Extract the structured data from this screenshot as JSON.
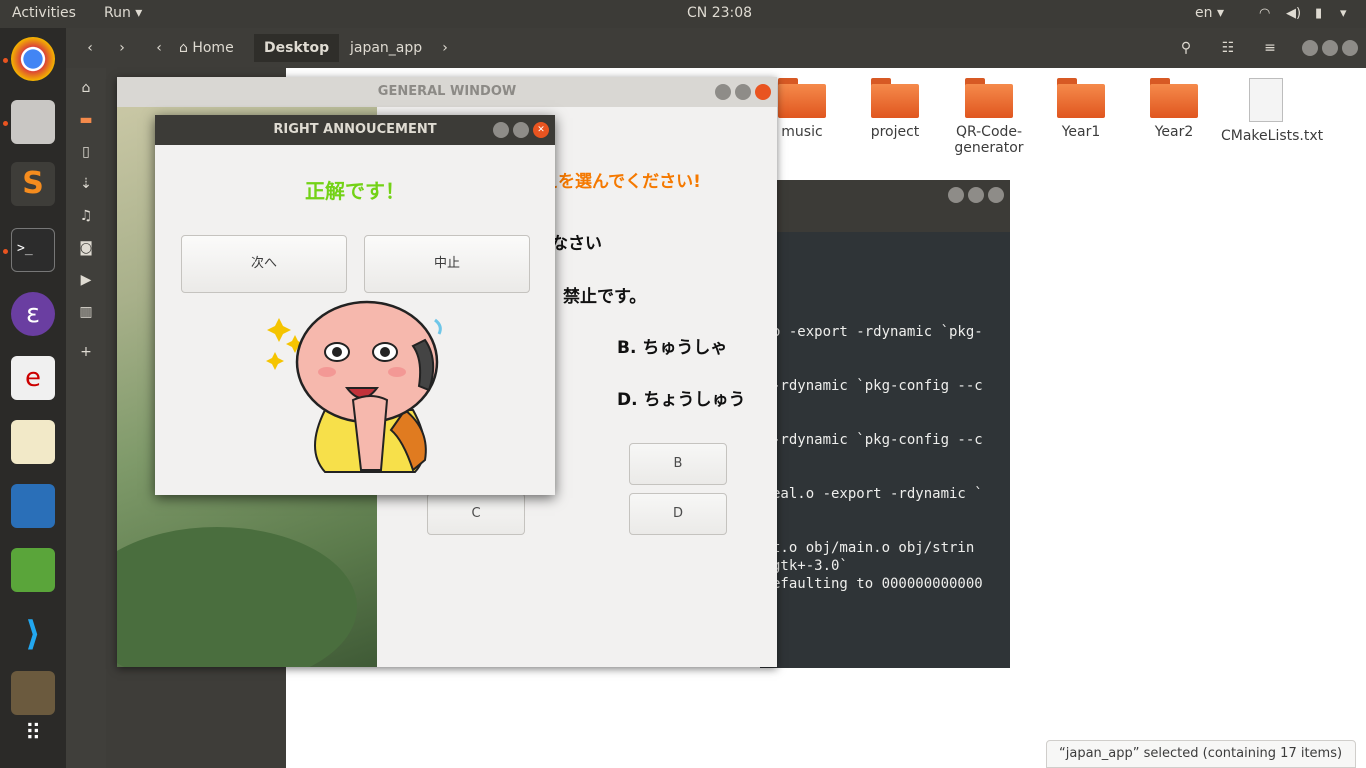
{
  "topbar": {
    "activities": "Activities",
    "app_menu": "Run",
    "clock": "CN 23:08",
    "lang": "en"
  },
  "files": {
    "breadcrumbs": [
      "Home",
      "Desktop",
      "japan_app"
    ],
    "items": [
      "music",
      "project",
      "QR-Code-generator",
      "Year1",
      "Year2",
      "CMakeLists.txt"
    ],
    "status": "“japan_app” selected  (containing 17 items)"
  },
  "terminal": {
    "lines": [
      "o -export -rdynamic `pkg-",
      "-rdynamic `pkg-config --c",
      "-rdynamic `pkg-config --c",
      "eal.o -export -rdynamic `",
      "t.o obj/main.o obj/strin",
      "gtk+-3.0`",
      "efaulting to 000000000000"
    ]
  },
  "general_window": {
    "title": "GENERAL WINDOW",
    "instruction": "えを選んでください!",
    "line1": "なさい",
    "line2": "禁止です。",
    "option_b": "B. ちゅうしゃ",
    "option_d": "D. ちょうしゅう",
    "btn_b": "B",
    "btn_c": "C",
    "btn_d": "D"
  },
  "dialog": {
    "title": "RIGHT ANNOUCEMENT",
    "message": "正解です！",
    "next_button": "次へ",
    "stop_button": "中止"
  },
  "colors": {
    "accent": "#e95420",
    "correct_green": "#73d216",
    "instruction_orange": "#f57900"
  }
}
